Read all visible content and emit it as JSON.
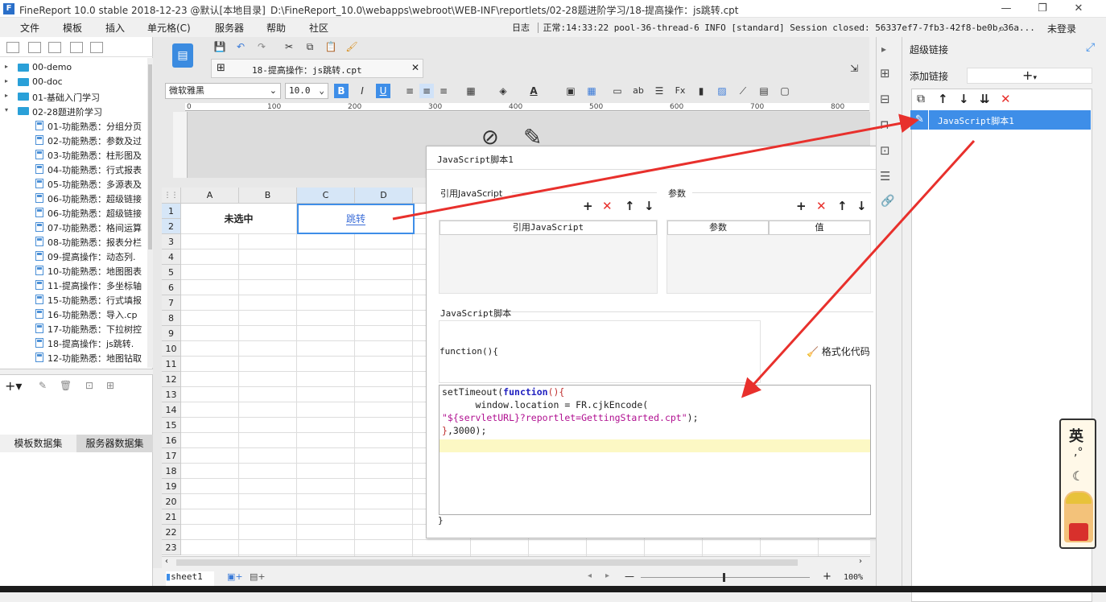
{
  "window": {
    "title": "FineReport 10.0 stable 2018-12-23 @默认[本地目录]",
    "path": "D:\\FineReport_10.0\\webapps\\webroot\\WEB-INF\\reportlets/02-28题进阶学习/18-提高操作：js跳转.cpt"
  },
  "menu": {
    "items": [
      "文件",
      "模板",
      "插入",
      "单元格(C)",
      "服务器",
      "帮助",
      "社区"
    ],
    "log_label": "日志",
    "log_text": "正常:14:33:22 pool-36-thread-6 INFO [standard] Session closed: 56337ef7-7fb3-42f8-be0b-36a...",
    "login": "未登录"
  },
  "tree": {
    "items": [
      {
        "label": "00-demo",
        "type": "folder",
        "expanded": false
      },
      {
        "label": "00-doc",
        "type": "folder",
        "expanded": false
      },
      {
        "label": "01-基础入门学习",
        "type": "folder",
        "expanded": false
      },
      {
        "label": "02-28题进阶学习",
        "type": "folder",
        "expanded": true
      },
      {
        "label": "01-功能熟悉：分组分页",
        "type": "file"
      },
      {
        "label": "02-功能熟悉：参数及过",
        "type": "file"
      },
      {
        "label": "03-功能熟悉：柱形图及",
        "type": "file"
      },
      {
        "label": "04-功能熟悉：行式报表",
        "type": "file"
      },
      {
        "label": "05-功能熟悉：多源表及",
        "type": "file"
      },
      {
        "label": "06-功能熟悉：超级链接",
        "type": "file"
      },
      {
        "label": "06-功能熟悉：超级链接",
        "type": "file"
      },
      {
        "label": "07-功能熟悉：格间运算",
        "type": "file"
      },
      {
        "label": "08-功能熟悉：报表分栏",
        "type": "file"
      },
      {
        "label": "09-提高操作：动态列.",
        "type": "file"
      },
      {
        "label": "10-功能熟悉：地图图表",
        "type": "file"
      },
      {
        "label": "11-提高操作：多坐标轴",
        "type": "file"
      },
      {
        "label": "15-功能熟悉：行式填报",
        "type": "file"
      },
      {
        "label": "16-功能熟悉：导入.cp",
        "type": "file"
      },
      {
        "label": "17-功能熟悉：下拉树控",
        "type": "file"
      },
      {
        "label": "18-提高操作：js跳转.",
        "type": "file"
      },
      {
        "label": "12-功能熟悉：地图钻取",
        "type": "file"
      }
    ]
  },
  "datasets": {
    "tab1": "模板数据集",
    "tab2": "服务器数据集"
  },
  "doc_tab": {
    "label": "18-提高操作：js跳转.cpt"
  },
  "format": {
    "font": "微软雅黑",
    "size": "10.0"
  },
  "ruler": [
    "0",
    "100",
    "200",
    "300",
    "400",
    "500",
    "600",
    "700",
    "800"
  ],
  "sheet": {
    "columns": [
      "A",
      "B",
      "C",
      "D"
    ],
    "rows": [
      "1",
      "2",
      "3",
      "4",
      "5",
      "6",
      "7",
      "8",
      "9",
      "10",
      "11",
      "12",
      "13",
      "14",
      "15",
      "16",
      "17",
      "18",
      "19",
      "20",
      "21",
      "22",
      "23"
    ],
    "cell_ab": "未选中",
    "cell_cd": "跳转",
    "tab": "sheet1",
    "zoom": "100%"
  },
  "dialog": {
    "title": "JavaScript脚本1",
    "ref_js_label": "引用JavaScript",
    "ref_js_header": "引用JavaScript",
    "params_label": "参数",
    "params_header": "参数",
    "value_header": "值",
    "script_label": "JavaScript脚本",
    "func_open": "function(){",
    "func_close": "}",
    "format_code": "格式化代码",
    "code": {
      "l1a": "setTimeout(",
      "l1b": "function",
      "l1c": "(){",
      "l2": "      window.location = FR.cjkEncode(",
      "l3": "\"${servletURL}?reportlet=GettingStarted.cpt\"",
      "l3b": ");",
      "l4a": "}",
      "l4b": ",3000);"
    }
  },
  "right_panel": {
    "title": "超级链接",
    "add_link": "添加链接",
    "item": "JavaScript脚本1"
  },
  "colors": {
    "accent": "#3e8ee8",
    "arrow": "#e8302c",
    "link": "#3c6ed8"
  }
}
